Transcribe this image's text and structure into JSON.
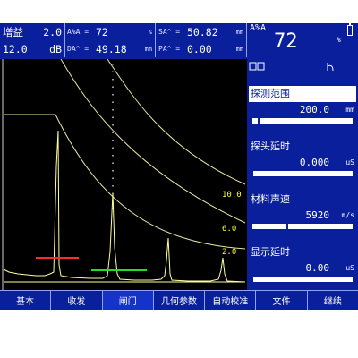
{
  "header": {
    "gain_label": "增益",
    "gain_value": "2.0",
    "db_gain_value": "12.0",
    "db_unit": "dB",
    "measurements": [
      {
        "key": "A%A =",
        "value": "72",
        "unit": "%"
      },
      {
        "key": "SA^ =",
        "value": "50.82",
        "unit": "mm"
      },
      {
        "key": "DA^ =",
        "value": "49.18",
        "unit": "mm"
      },
      {
        "key": "PA^ =",
        "value": "0.00",
        "unit": "mm"
      }
    ],
    "big_tag": "A%A",
    "big_value": "72",
    "big_unit": "%"
  },
  "side": {
    "panels": [
      {
        "title": "探测范围",
        "value": "200.0",
        "unit": "mm",
        "level": 0.06,
        "selected": true
      },
      {
        "title": "探头延时",
        "value": "0.000",
        "unit": "uS",
        "level": 0.0,
        "selected": false
      },
      {
        "title": "材料声速",
        "value": "5920",
        "unit": "m/s",
        "level": 0.35,
        "selected": false
      },
      {
        "title": "显示延时",
        "value": "0.00",
        "unit": "uS",
        "level": 0.0,
        "selected": false
      }
    ]
  },
  "curve_labels": [
    "10.0",
    "6.0",
    "2.0"
  ],
  "menu": [
    "基本",
    "收发",
    "闸门",
    "几何参数",
    "自动校准",
    "文件",
    "继续"
  ],
  "colors": {
    "background": "#0a1f9c",
    "waveform": "#ffff99",
    "dac_curve": "#e8e8a0",
    "gate_a": "#ff2a2a",
    "gate_b": "#22dd22",
    "curve_label": "#ffff33"
  }
}
